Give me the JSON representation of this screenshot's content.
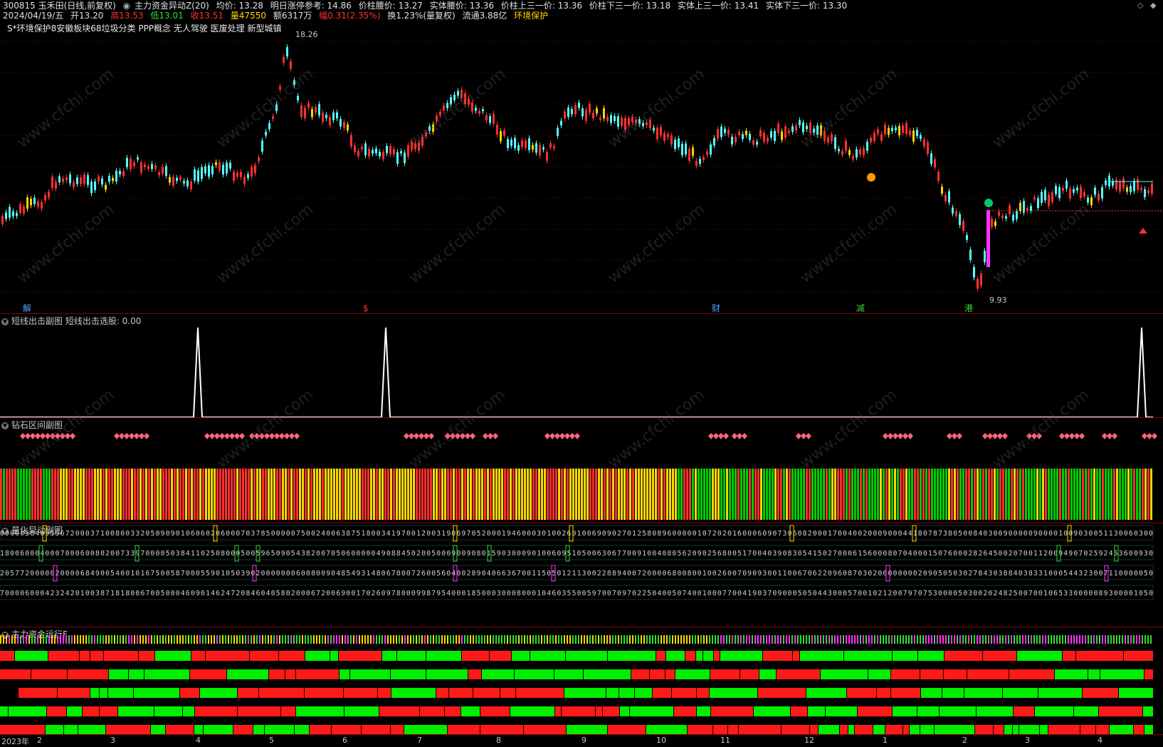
{
  "header": {
    "code_name": "300815 玉禾田(日线,前复权)",
    "indicator": "主力资金异动Z(20)",
    "avg_price": "均价: 13.28",
    "next_limit": "明日涨停参考: 14.86",
    "waist_price": "价柱腰价: 13.27",
    "body_waist": "实体腰价: 13.36",
    "upper_third": "价柱上三一价: 13.36",
    "lower_third": "价柱下三一价: 13.18",
    "body_upper_third": "实体上三一价: 13.41",
    "body_lower_third": "实体下三一价: 13.30"
  },
  "header2": {
    "date": "2024/04/19/五",
    "open": "开13.20",
    "high": "高13.53",
    "low": "低13.01",
    "close": "收13.51",
    "volume": "量47550",
    "amount": "额6317万",
    "change": "幅0.31(2.35%)",
    "turnover": "换1.23%(量复权)",
    "float": "流通3.88亿",
    "sector": "环境保护"
  },
  "concepts": "S*环境保护8安徽板块68垃圾分类 PPP概念 无人驾驶 医废处理 新型城镇",
  "price_labels": {
    "high": "18.26",
    "low": "9.93"
  },
  "bottom_markers": [
    {
      "text": "解",
      "color": "#4aa3ff"
    },
    {
      "text": "$",
      "color": "#ff3030"
    },
    {
      "text": "财",
      "color": "#4aa3ff"
    },
    {
      "text": "减",
      "color": "#33dd33"
    },
    {
      "text": "港",
      "color": "#33dd33"
    }
  ],
  "panels": {
    "short_line": "短线出击副图  短线出击选股: 0.00",
    "diamond": "钻石区间副图",
    "quant": "量化异动副图",
    "main_fund": "主力资金运行F"
  },
  "months": [
    "2023年",
    "2",
    "3",
    "4",
    "5",
    "6",
    "7",
    "8",
    "9",
    "10",
    "11",
    "12",
    "1",
    "2",
    "3",
    "4"
  ],
  "colors": {
    "up": "#ff3030",
    "down": "#54ffff",
    "yellow": "#ffd700",
    "green": "#00cc00",
    "magenta": "#ff33ff",
    "grid": "#8b0000"
  },
  "watermark": "www.cfchi.com"
}
